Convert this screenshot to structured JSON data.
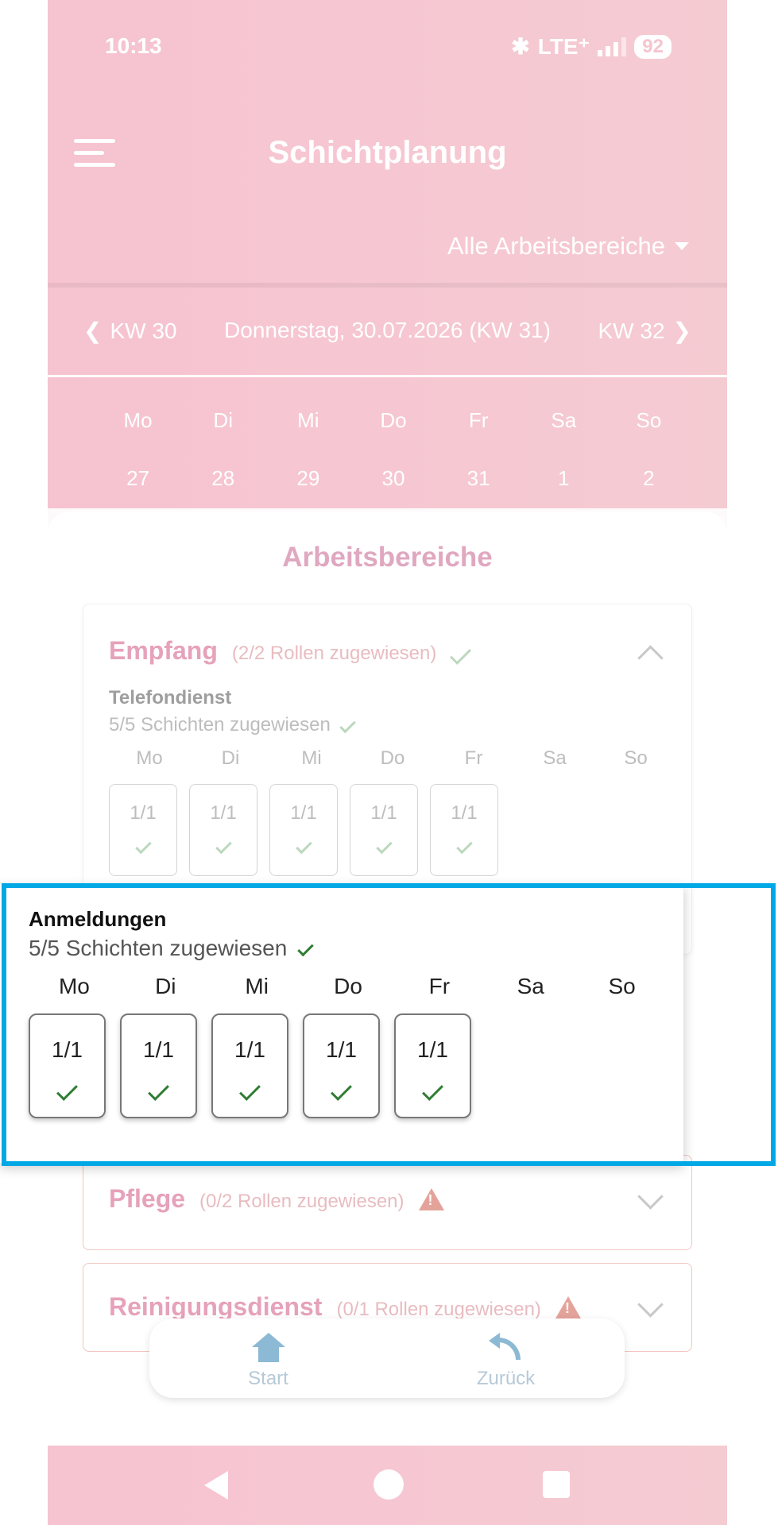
{
  "status_bar": {
    "time": "10:13",
    "network": "LTE⁺",
    "battery": "92"
  },
  "app_bar": {
    "title": "Schichtplanung",
    "area_filter": "Alle Arbeitsbereiche"
  },
  "week_nav": {
    "prev": "KW 30",
    "current": "Donnerstag, 30.07.2026 (KW 31)",
    "next": "KW 32"
  },
  "week_days": [
    {
      "day": "Mo",
      "date": "27"
    },
    {
      "day": "Di",
      "date": "28"
    },
    {
      "day": "Mi",
      "date": "29"
    },
    {
      "day": "Do",
      "date": "30"
    },
    {
      "day": "Fr",
      "date": "31"
    },
    {
      "day": "Sa",
      "date": "1"
    },
    {
      "day": "So",
      "date": "2"
    }
  ],
  "section_title": "Arbeitsbereiche",
  "areas": [
    {
      "name": "Empfang",
      "count": "(2/2 Rollen zugewiesen)",
      "roles": [
        {
          "name": "Telefondienst",
          "subtitle": "5/5 Schichten zugewiesen",
          "slots": [
            "1/1",
            "1/1",
            "1/1",
            "1/1",
            "1/1"
          ]
        },
        {
          "name": "Anmeldungen",
          "subtitle": "5/5 Schichten zugewiesen",
          "slots": [
            "1/1",
            "1/1",
            "1/1",
            "1/1",
            "1/1"
          ]
        }
      ]
    },
    {
      "name": "Pflege",
      "count": "(0/2 Rollen zugewiesen)"
    },
    {
      "name": "Reinigungsdienst",
      "count": "(0/1 Rollen zugewiesen)"
    }
  ],
  "weekday_labels": [
    "Mo",
    "Di",
    "Mi",
    "Do",
    "Fr",
    "Sa",
    "So"
  ],
  "bottom_nav": {
    "start": "Start",
    "back": "Zurück"
  },
  "colors": {
    "header": "#f6c3d1",
    "accent": "#e6a2ba",
    "highlight": "#00a8e6",
    "check": "#2e7d32",
    "warning": "#e4a39a"
  }
}
